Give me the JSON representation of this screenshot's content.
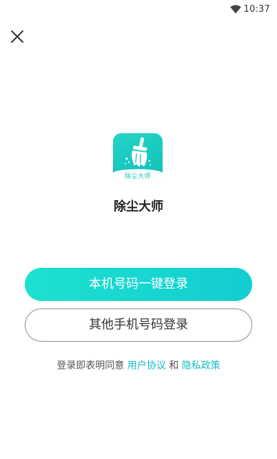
{
  "status_bar": {
    "time": "10:37",
    "wifi_icon": "wifi-icon"
  },
  "header": {
    "close_icon": "close-icon"
  },
  "app": {
    "logo_text": "除尘大师",
    "name": "除尘大师",
    "logo_icon": "broom-icon"
  },
  "buttons": {
    "one_click_login": "本机号码一键登录",
    "other_phone_login": "其他手机号码登录"
  },
  "agreement": {
    "prefix": "登录即表明同意",
    "user_agreement": "用户协议",
    "connector": "和",
    "privacy_policy": "隐私政策"
  },
  "colors": {
    "accent": "#14bdc4",
    "primary_button": "#1ee0cf",
    "logo_bg": "#25d3c8"
  }
}
